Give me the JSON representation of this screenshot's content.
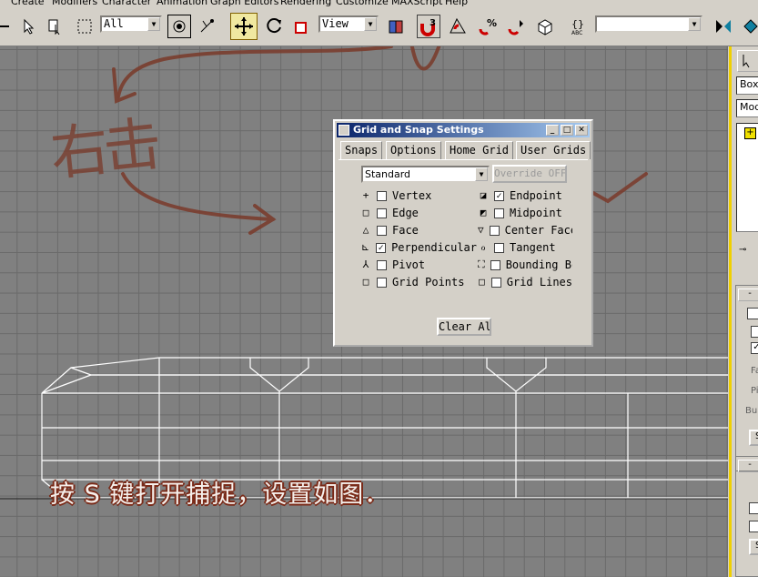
{
  "menu": [
    "Create",
    "Modifiers",
    "Character",
    "Animation",
    "Graph Editors",
    "Rendering",
    "Customize",
    "MAXScript",
    "Help"
  ],
  "toolbar": {
    "selection_filter": "All",
    "reference_coord": "View",
    "named_selection": ""
  },
  "dialog": {
    "title": "Grid and Snap Settings",
    "tabs": [
      "Snaps",
      "Options",
      "Home Grid",
      "User Grids"
    ],
    "active_tab": "Snaps",
    "snap_type": "Standard",
    "override_label": "Override OFF",
    "left_options": [
      {
        "label": "Vertex",
        "checked": false,
        "icon": "+"
      },
      {
        "label": "Edge",
        "checked": false,
        "icon": "□"
      },
      {
        "label": "Face",
        "checked": false,
        "icon": "△"
      },
      {
        "label": "Perpendicular",
        "checked": true,
        "icon": "⊾"
      },
      {
        "label": "Pivot",
        "checked": false,
        "icon": "⅄"
      },
      {
        "label": "Grid Points",
        "checked": false,
        "icon": "□"
      }
    ],
    "right_options": [
      {
        "label": "Endpoint",
        "checked": true,
        "icon": "◪"
      },
      {
        "label": "Midpoint",
        "checked": false,
        "icon": "◩"
      },
      {
        "label": "Center Face",
        "checked": false,
        "icon": "▽"
      },
      {
        "label": "Tangent",
        "checked": false,
        "icon": "ℴ"
      },
      {
        "label": "Bounding Box",
        "checked": false,
        "icon": "⛶"
      },
      {
        "label": "Grid Lines",
        "checked": false,
        "icon": "□"
      }
    ],
    "clear_all": "Clear All"
  },
  "annotation": {
    "handwritten": "右击"
  },
  "caption": "按 S 键打开捕捉，设置如图．",
  "command_panel": {
    "object_type": "Box",
    "modifier": "Mod",
    "labels": [
      "Fa",
      "Pi",
      "Bub"
    ],
    "button": "S"
  },
  "colors": {
    "annotation": "#7a3a2a",
    "accent": "#f0d000"
  }
}
